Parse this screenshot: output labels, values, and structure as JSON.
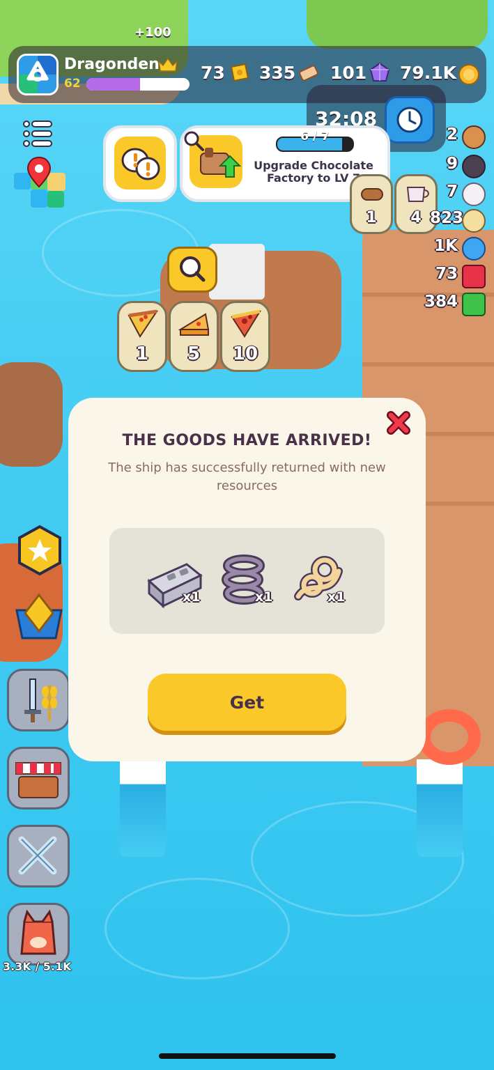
{
  "hud": {
    "xp_popup": "+100",
    "player_name": "Dragonden",
    "level": "62",
    "xp_progress": 0.52,
    "resources": [
      {
        "icon": "ticket-icon",
        "value": "73"
      },
      {
        "icon": "scroll-icon",
        "value": "335"
      },
      {
        "icon": "gem-icon",
        "value": "101"
      },
      {
        "icon": "coin-icon",
        "value": "79.1K"
      }
    ],
    "timer": "32:08"
  },
  "quest": {
    "progress_text": "6 / 7",
    "progress": 0.857,
    "title": "Upgrade Chocolate Factory to LV 7"
  },
  "orders": {
    "pizza": [
      {
        "icon": "pizza-slice-icon",
        "count": "1"
      },
      {
        "icon": "cheese-icon",
        "count": "5"
      },
      {
        "icon": "pepperoni-pizza-icon",
        "count": "10"
      }
    ],
    "top": [
      {
        "icon": "log-icon",
        "count": "1"
      },
      {
        "icon": "cup-icon",
        "count": "4"
      }
    ]
  },
  "inventory": [
    {
      "icon": "bread-icon",
      "value": "2"
    },
    {
      "icon": "pot-icon",
      "value": "9"
    },
    {
      "icon": "cotton-icon",
      "value": "7"
    },
    {
      "icon": "egg-icon",
      "value": "823"
    },
    {
      "icon": "blue-gem-icon",
      "value": "1K"
    },
    {
      "icon": "ruby-icon",
      "value": "73"
    },
    {
      "icon": "emerald-icon",
      "value": "384"
    }
  ],
  "sidebar": {
    "bag_capacity": "3.3K / 5.1K"
  },
  "modal": {
    "title": "THE GOODS HAVE ARRIVED!",
    "subtitle": "The ship has successfully returned with new resources",
    "rewards": [
      {
        "icon": "cinder-block-icon",
        "qty": "x1"
      },
      {
        "icon": "spring-icon",
        "qty": "x1"
      },
      {
        "icon": "rope-icon",
        "qty": "x1"
      }
    ],
    "get_label": "Get"
  },
  "colors": {
    "water": "#45cdf3",
    "modal_bg": "#fbf6ea",
    "button": "#fbc82a",
    "title": "#4a3048",
    "xp": "#b56be8"
  }
}
